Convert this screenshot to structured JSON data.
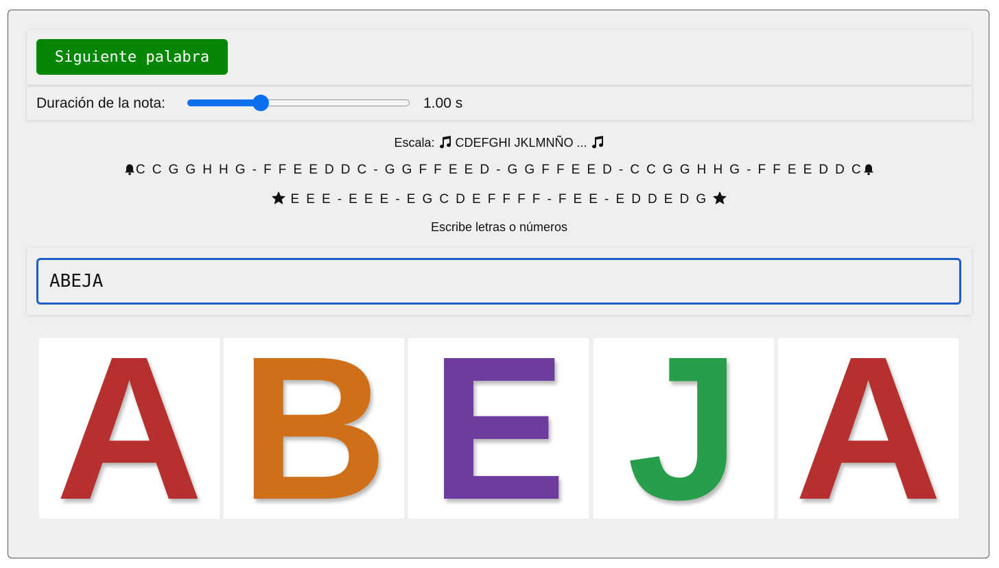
{
  "toolbar": {
    "next_label": "Siguiente palabra"
  },
  "slider": {
    "label": "Duración de la nota:",
    "value_text": "1.00 s",
    "fraction": 0.33
  },
  "scale": {
    "text": "Escala:",
    "notes": "CDEFGHI JKLMNÑO ..."
  },
  "songs": [
    {
      "icon": "bell-icon",
      "notes": "C C G G H H G - F F E E D D C - G G F F E E D - G G F F E E D - C C G G H H G - F F E E D D C"
    },
    {
      "icon": "star-icon",
      "notes": "E E E - E E E - E G C D E F F F F - F E E - E D D E D G"
    }
  ],
  "hint": "Escribe letras o números",
  "word_input": {
    "value": "ABEJA"
  },
  "tiles": [
    {
      "letter": "A",
      "color": "#b5302e"
    },
    {
      "letter": "B",
      "color": "#cf7018"
    },
    {
      "letter": "E",
      "color": "#6f3b9e"
    },
    {
      "letter": "J",
      "color": "#279e4a"
    },
    {
      "letter": "A",
      "color": "#b5302e"
    }
  ]
}
